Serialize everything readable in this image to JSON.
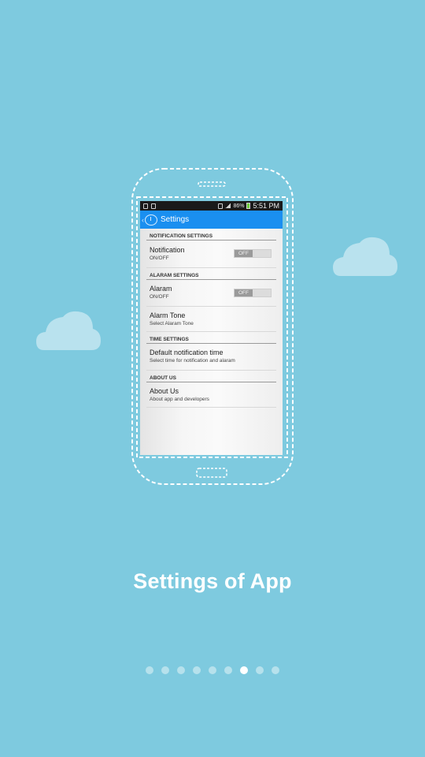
{
  "colors": {
    "background": "#7ecadf",
    "actionbar": "#1a8ff0",
    "cloud": "#b9e2ee"
  },
  "statusbar": {
    "left_icons": [
      "usb-icon",
      "sd-card-icon"
    ],
    "right_icons": [
      "mute-icon",
      "signal-icon",
      "battery-icon"
    ],
    "battery_text": "86%",
    "time": "5:51 PM"
  },
  "actionbar": {
    "back_glyph": "‹",
    "app_icon": "alarm-clock-icon",
    "title": "Settings"
  },
  "sections": {
    "notification": {
      "header": "NOTIFICATION SETTINGS",
      "item": {
        "title": "Notification",
        "subtitle": "ON/OFF",
        "toggle": "OFF"
      }
    },
    "alarm": {
      "header": "ALARAM SETTINGS",
      "item": {
        "title": "Alaram",
        "subtitle": "ON/OFF",
        "toggle": "OFF"
      },
      "tone": {
        "title": "Alarm Tone",
        "subtitle": "Select Alaram Tone"
      }
    },
    "time": {
      "header": "TIME SETTINGS",
      "item": {
        "title": "Default notification time",
        "subtitle": "Select time for notification and alaram"
      }
    },
    "about": {
      "header": "ABOUT US",
      "item": {
        "title": "About Us",
        "subtitle": "About app and developers"
      }
    }
  },
  "caption": "Settings of App",
  "pager": {
    "count": 9,
    "active_index": 6
  }
}
